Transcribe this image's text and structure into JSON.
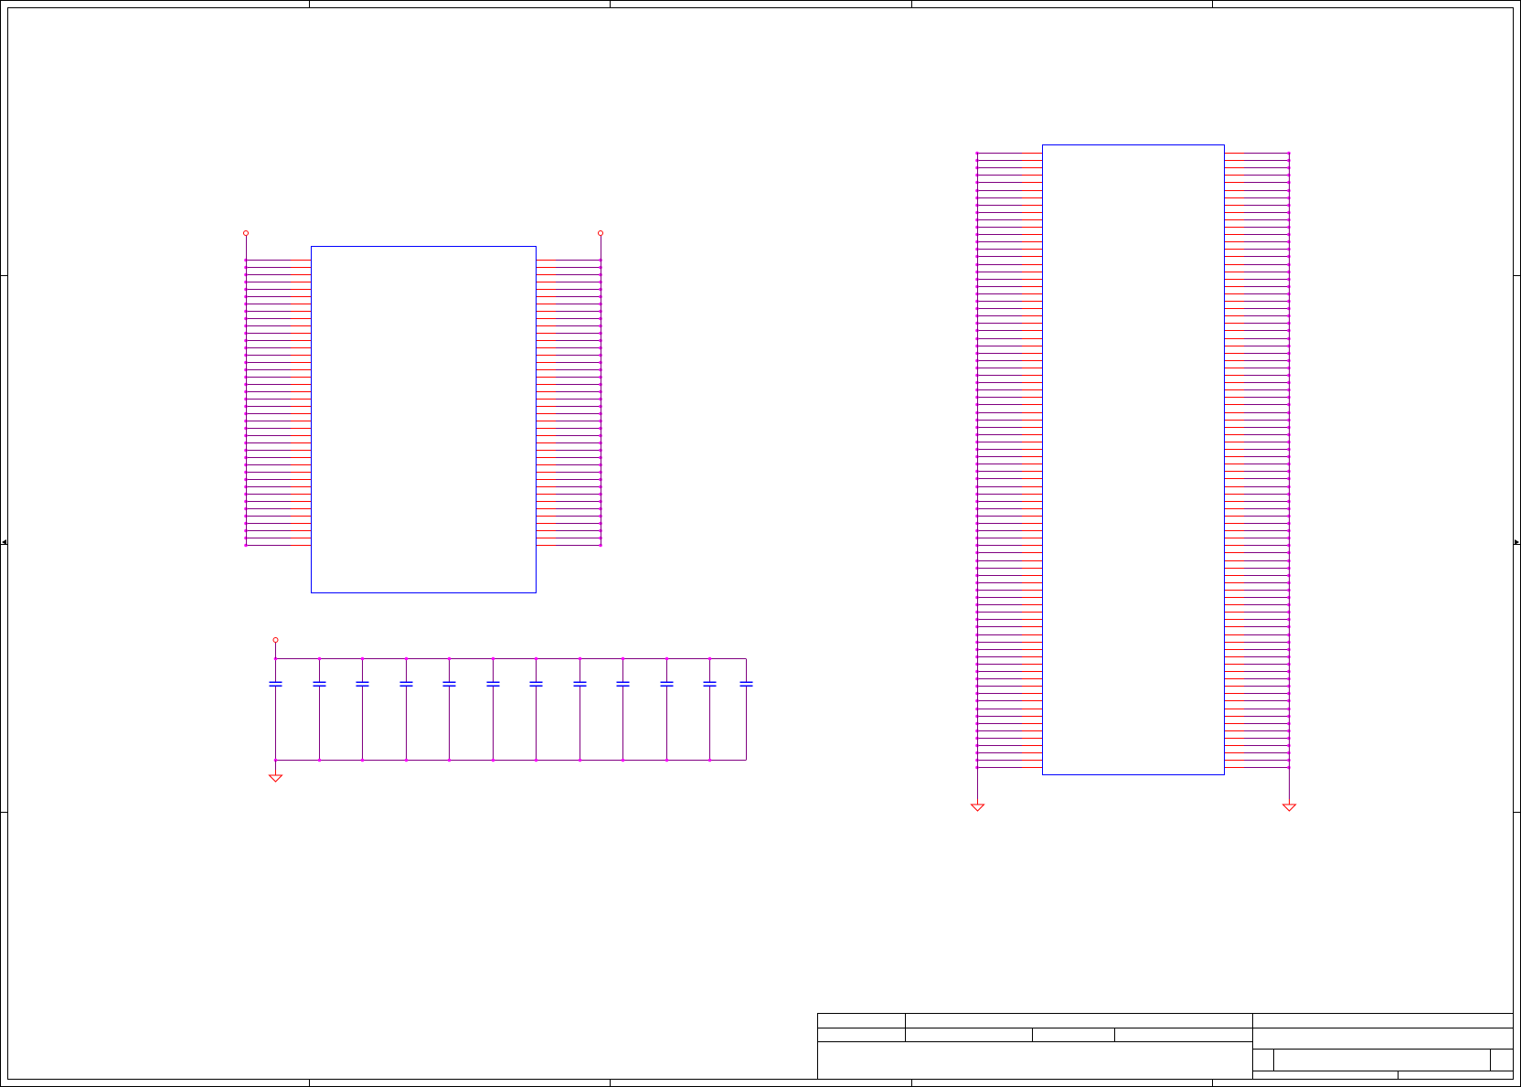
{
  "sheet": {
    "background": "#ffffff",
    "border_color": "#000000",
    "zone_columns": 5,
    "zone_rows": 4
  },
  "colors": {
    "body_outline": "#0000ff",
    "pin_line": "#ff0000",
    "net_wire": "#800080",
    "junction": "#ff00ff",
    "power_symbol": "#ff0000",
    "capacitor": "#0000ff",
    "title_block": "#000000"
  },
  "components": {
    "left_ic": {
      "pins_per_side": 40,
      "power_ports": 2
    },
    "decoupling_capacitors": {
      "count": 12,
      "power_port": "vcc-circle",
      "ground_port": "ground-triangle"
    },
    "right_connector": {
      "pins_per_side": 84,
      "ground_ports": 2
    }
  },
  "title_block": {
    "fields": []
  }
}
